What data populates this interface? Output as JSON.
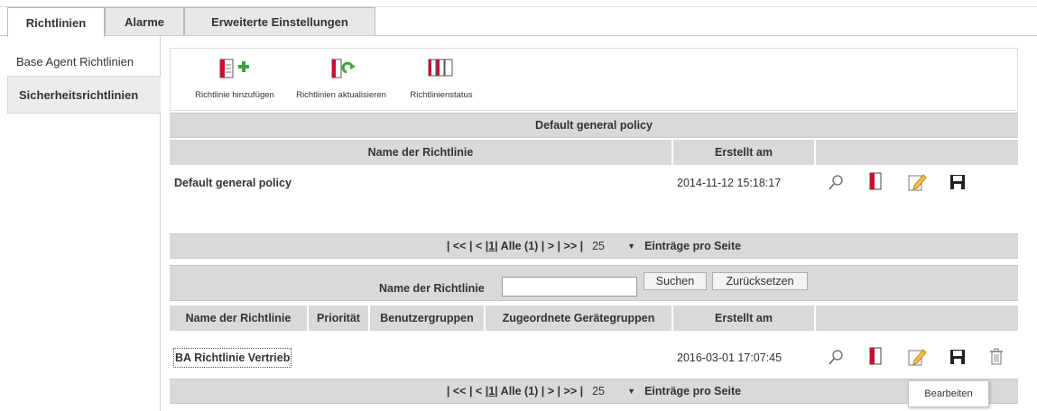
{
  "tabs": [
    {
      "label": "Richtlinien",
      "active": true
    },
    {
      "label": "Alarme",
      "active": false
    },
    {
      "label": "Erweiterte Einstellungen",
      "active": false
    }
  ],
  "sidebar": {
    "items": [
      {
        "label": "Base Agent Richtlinien",
        "active": false
      },
      {
        "label": "Sicherheitsrichtlinien",
        "active": true
      }
    ]
  },
  "toolbar": {
    "add_label": "Richtlinie hinzufügen",
    "update_label": "Richtlinien aktualisieren",
    "status_label": "Richtlinienstatus"
  },
  "default_section": {
    "title": "Default general policy",
    "columns": {
      "name": "Name der Richtlinie",
      "created": "Erstellt am"
    },
    "rows": [
      {
        "name": "Default general policy",
        "created": "2014-11-12 15:18:17"
      }
    ],
    "pager": {
      "prefix": "| << | < | ",
      "page": "1",
      "suffix": " | Alle (1) | > | >> |",
      "per_page": "25",
      "per_page_label": "Einträge pro Seite"
    }
  },
  "search": {
    "label": "Name der Richtlinie",
    "value": "",
    "search_button": "Suchen",
    "reset_button": "Zurücksetzen"
  },
  "policy_table": {
    "columns": {
      "name": "Name der Richtlinie",
      "priority": "Priorität",
      "user_groups": "Benutzergruppen",
      "device_groups": "Zugeordnete Gerätegruppen",
      "created": "Erstellt am"
    },
    "rows": [
      {
        "name": "BA Richtlinie Vertrieb",
        "created": "2016-03-01 17:07:45"
      }
    ],
    "pager": {
      "prefix": "| << | < | ",
      "page": "1",
      "suffix": " | Alle (1) | > | >> |",
      "per_page": "25",
      "per_page_label": "Einträge pro Seite"
    }
  },
  "tooltip": {
    "text": "Bearbeiten"
  },
  "icons": {
    "add": "policy-add-icon",
    "update": "policy-refresh-icon",
    "status": "policy-status-icon",
    "view": "magnifier-icon",
    "policy": "policy-book-icon",
    "edit": "pencil-edit-icon",
    "save": "floppy-save-icon",
    "delete": "trash-icon"
  },
  "colors": {
    "accent_red": "#c8102e",
    "accent_green": "#3aa53a",
    "header_gray": "#d9d9d9"
  }
}
